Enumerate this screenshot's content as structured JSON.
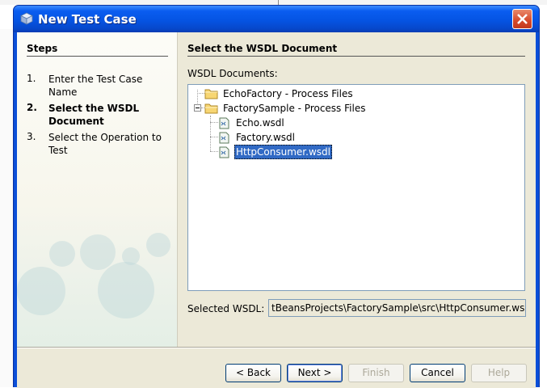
{
  "window": {
    "title": "New Test Case"
  },
  "steps": {
    "title": "Steps",
    "items": [
      {
        "num": "1.",
        "label": "Enter the Test Case Name",
        "active": false
      },
      {
        "num": "2.",
        "label": "Select the WSDL Document",
        "active": true
      },
      {
        "num": "3.",
        "label": "Select the Operation to Test",
        "active": false
      }
    ]
  },
  "content": {
    "title": "Select the WSDL Document",
    "wsdl_label": "WSDL Documents:",
    "tree": [
      {
        "label": "EchoFactory - Process Files",
        "icon": "folder-icon",
        "level": 0,
        "expanded": false
      },
      {
        "label": "FactorySample - Process Files",
        "icon": "folder-icon",
        "level": 0,
        "expanded": true
      },
      {
        "label": "Echo.wsdl",
        "icon": "wsdl-file-icon",
        "level": 1
      },
      {
        "label": "Factory.wsdl",
        "icon": "wsdl-file-icon",
        "level": 1
      },
      {
        "label": "HttpConsumer.wsdl",
        "icon": "wsdl-file-icon",
        "level": 1,
        "selected": true
      }
    ],
    "selected_label": "Selected WSDL:",
    "selected_value": "tBeansProjects\\FactorySample\\src\\HttpConsumer.wsdl"
  },
  "buttons": {
    "back": "< Back",
    "next": "Next >",
    "finish": "Finish",
    "cancel": "Cancel",
    "help": "Help"
  },
  "colors": {
    "titlebar": "#0554e3",
    "dialog_bg": "#ece9d8",
    "selection": "#316ac5",
    "close": "#d6482a"
  }
}
